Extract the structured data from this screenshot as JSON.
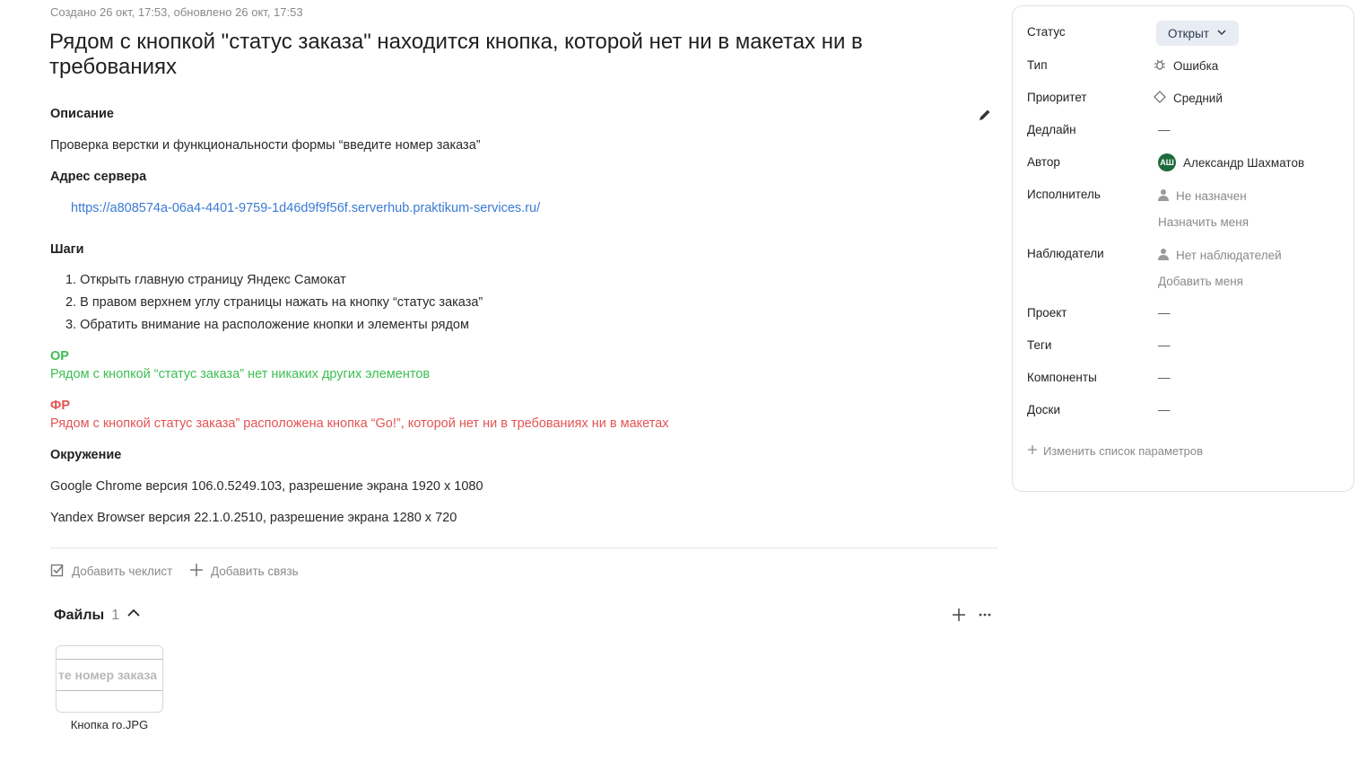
{
  "issue": {
    "meta": "Создано 26 окт, 17:53, обновлено 26 окт, 17:53",
    "title": "Рядом с кнопкой \"статус заказа\" находится кнопка, которой нет ни в макетах ни в требованиях"
  },
  "description": {
    "heading": "Описание",
    "text": "Проверка верстки и функциональности формы “введите номер заказа”",
    "server_heading": "Адрес сервера",
    "server_url": "https://a808574a-06a4-4401-9759-1d46d9f9f56f.serverhub.praktikum-services.ru/",
    "steps_heading": "Шаги",
    "steps": [
      "1. Открыть главную страницу Яндекс Самокат",
      "2. В правом верхнем углу страницы нажать на кнопку “статус заказа”",
      "3. Обратить внимание на расположение кнопки и элементы рядом"
    ],
    "expected_heading": "ОР",
    "expected_text": "Рядом с кнопкой “статус заказа” нет никаких других элементов",
    "actual_heading": "ФР",
    "actual_text": "Рядом с кнопкой статус заказа” расположена кнопка “Go!”, которой нет ни в требованиях ни в макетах",
    "env_heading": "Окружение",
    "env_lines": [
      "Google Chrome версия 106.0.5249.103, разрешение экрана 1920 x 1080",
      "Yandex Browser версия 22.1.0.2510, разрешение экрана 1280 x 720"
    ]
  },
  "actions": {
    "add_checklist": "Добавить чеклист",
    "add_link": "Добавить связь"
  },
  "files": {
    "title": "Файлы",
    "count": "1",
    "items": [
      {
        "thumb_text": "те номер заказа",
        "name": "Кнопка го.JPG"
      }
    ]
  },
  "sidebar": {
    "status_label": "Статус",
    "status_value": "Открыт",
    "type_label": "Тип",
    "type_value": "Ошибка",
    "priority_label": "Приоритет",
    "priority_value": "Средний",
    "deadline_label": "Дедлайн",
    "deadline_value": "—",
    "author_label": "Автор",
    "author_initials": "АШ",
    "author_value": "Александр Шахматов",
    "assignee_label": "Исполнитель",
    "assignee_value": "Не назначен",
    "assign_me": "Назначить меня",
    "watchers_label": "Наблюдатели",
    "watchers_value": "Нет наблюдателей",
    "add_me": "Добавить меня",
    "project_label": "Проект",
    "project_value": "—",
    "tags_label": "Теги",
    "tags_value": "—",
    "components_label": "Компоненты",
    "components_value": "—",
    "boards_label": "Доски",
    "boards_value": "—",
    "change_params": "Изменить список параметров"
  },
  "colors": {
    "expected": "#3cbf52",
    "actual": "#e45353",
    "link": "#3a7bd5",
    "avatar_bg": "#1d6a3d"
  },
  "icons": {
    "edit": "pencil-icon",
    "checklist": "checkbox-icon",
    "add": "plus-icon",
    "collapse": "chevron-up-icon",
    "more": "ellipsis-icon",
    "status_dropdown": "chevron-down-icon",
    "type": "bug-icon",
    "priority": "diamond-icon",
    "person": "person-icon"
  }
}
